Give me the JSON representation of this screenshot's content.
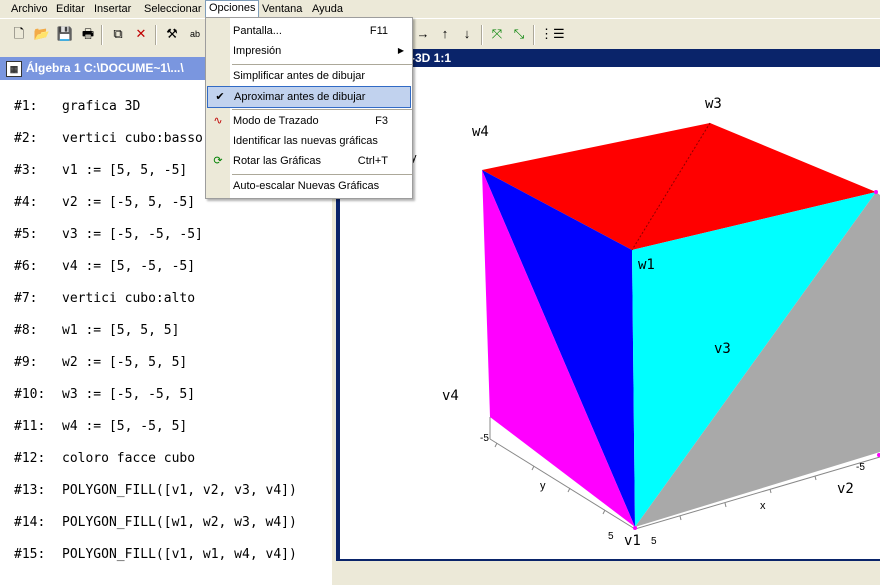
{
  "menubar": {
    "items": [
      "Archivo",
      "Editar",
      "Insertar",
      "Seleccionar",
      "Opciones",
      "Ventana",
      "Ayuda"
    ]
  },
  "algebra_window": {
    "title": "Álgebra 1  C:\\DOCUME~1\\...\\",
    "expressions": [
      {
        "num": "#1:",
        "text": "grafica 3D"
      },
      {
        "num": "#2:",
        "text": "vertici cubo:basso"
      },
      {
        "num": "#3:",
        "text": "v1 := [5, 5, -5]"
      },
      {
        "num": "#4:",
        "text": "v2 := [-5, 5, -5]"
      },
      {
        "num": "#5:",
        "text": "v3 := [-5, -5, -5]"
      },
      {
        "num": "#6:",
        "text": "v4 := [5, -5, -5]"
      },
      {
        "num": "#7:",
        "text": "vertici cubo:alto"
      },
      {
        "num": "#8:",
        "text": "w1 := [5, 5, 5]"
      },
      {
        "num": "#9:",
        "text": "w2 := [-5, 5, 5]"
      },
      {
        "num": "#10:",
        "text": "w3 := [-5, -5, 5]"
      },
      {
        "num": "#11:",
        "text": "w4 := [5, -5, 5]"
      },
      {
        "num": "#12:",
        "text": "coloro facce cubo"
      },
      {
        "num": "#13:",
        "text": "POLYGON_FILL([v1, v2, v3, v4])"
      },
      {
        "num": "#14:",
        "text": "POLYGON_FILL([w1, w2, w3, w4])"
      },
      {
        "num": "#15:",
        "text": "POLYGON_FILL([v1, w1, w4, v4])"
      }
    ]
  },
  "plot_window": {
    "title": "-3D 1:1",
    "vertex_labels": {
      "w3": "w3",
      "w4": "w4",
      "w1": "w1",
      "v3": "v3",
      "v4": "v4",
      "v2": "v2",
      "v1": "v1"
    },
    "axis_labels": {
      "y_top": "y",
      "y": "y",
      "x": "x"
    },
    "tick_labels": {
      "neg5_left": "-5",
      "neg5_right": "-5",
      "pos5_bottom_left": "5",
      "pos5_bottom_mid": "5"
    },
    "colors": {
      "top": "#ff0000",
      "left_blue": "#0000ff",
      "left_magenta": "#ff00ff",
      "front": "#00ffff",
      "right": "#a9a9a9"
    }
  },
  "opciones_menu": {
    "items": [
      {
        "label": "Pantalla...",
        "shortcut": "F11",
        "icon": ""
      },
      {
        "label": "Impresión",
        "shortcut": "",
        "icon": "",
        "submenu": true
      },
      {
        "label": "Simplificar antes de dibujar",
        "shortcut": "",
        "icon": ""
      },
      {
        "label": "Aproximar antes de dibujar",
        "shortcut": "",
        "icon": "check-icon",
        "checked": true
      },
      {
        "label": "Modo de Trazado",
        "shortcut": "F3",
        "icon": "trace-icon"
      },
      {
        "label": "Identificar las nuevas gráficas",
        "shortcut": "",
        "icon": ""
      },
      {
        "label": "Rotar las Gráficas",
        "shortcut": "Ctrl+T",
        "icon": "rotate-icon"
      },
      {
        "label": "Auto-escalar Nuevas Gráficas",
        "shortcut": "",
        "icon": ""
      }
    ]
  }
}
